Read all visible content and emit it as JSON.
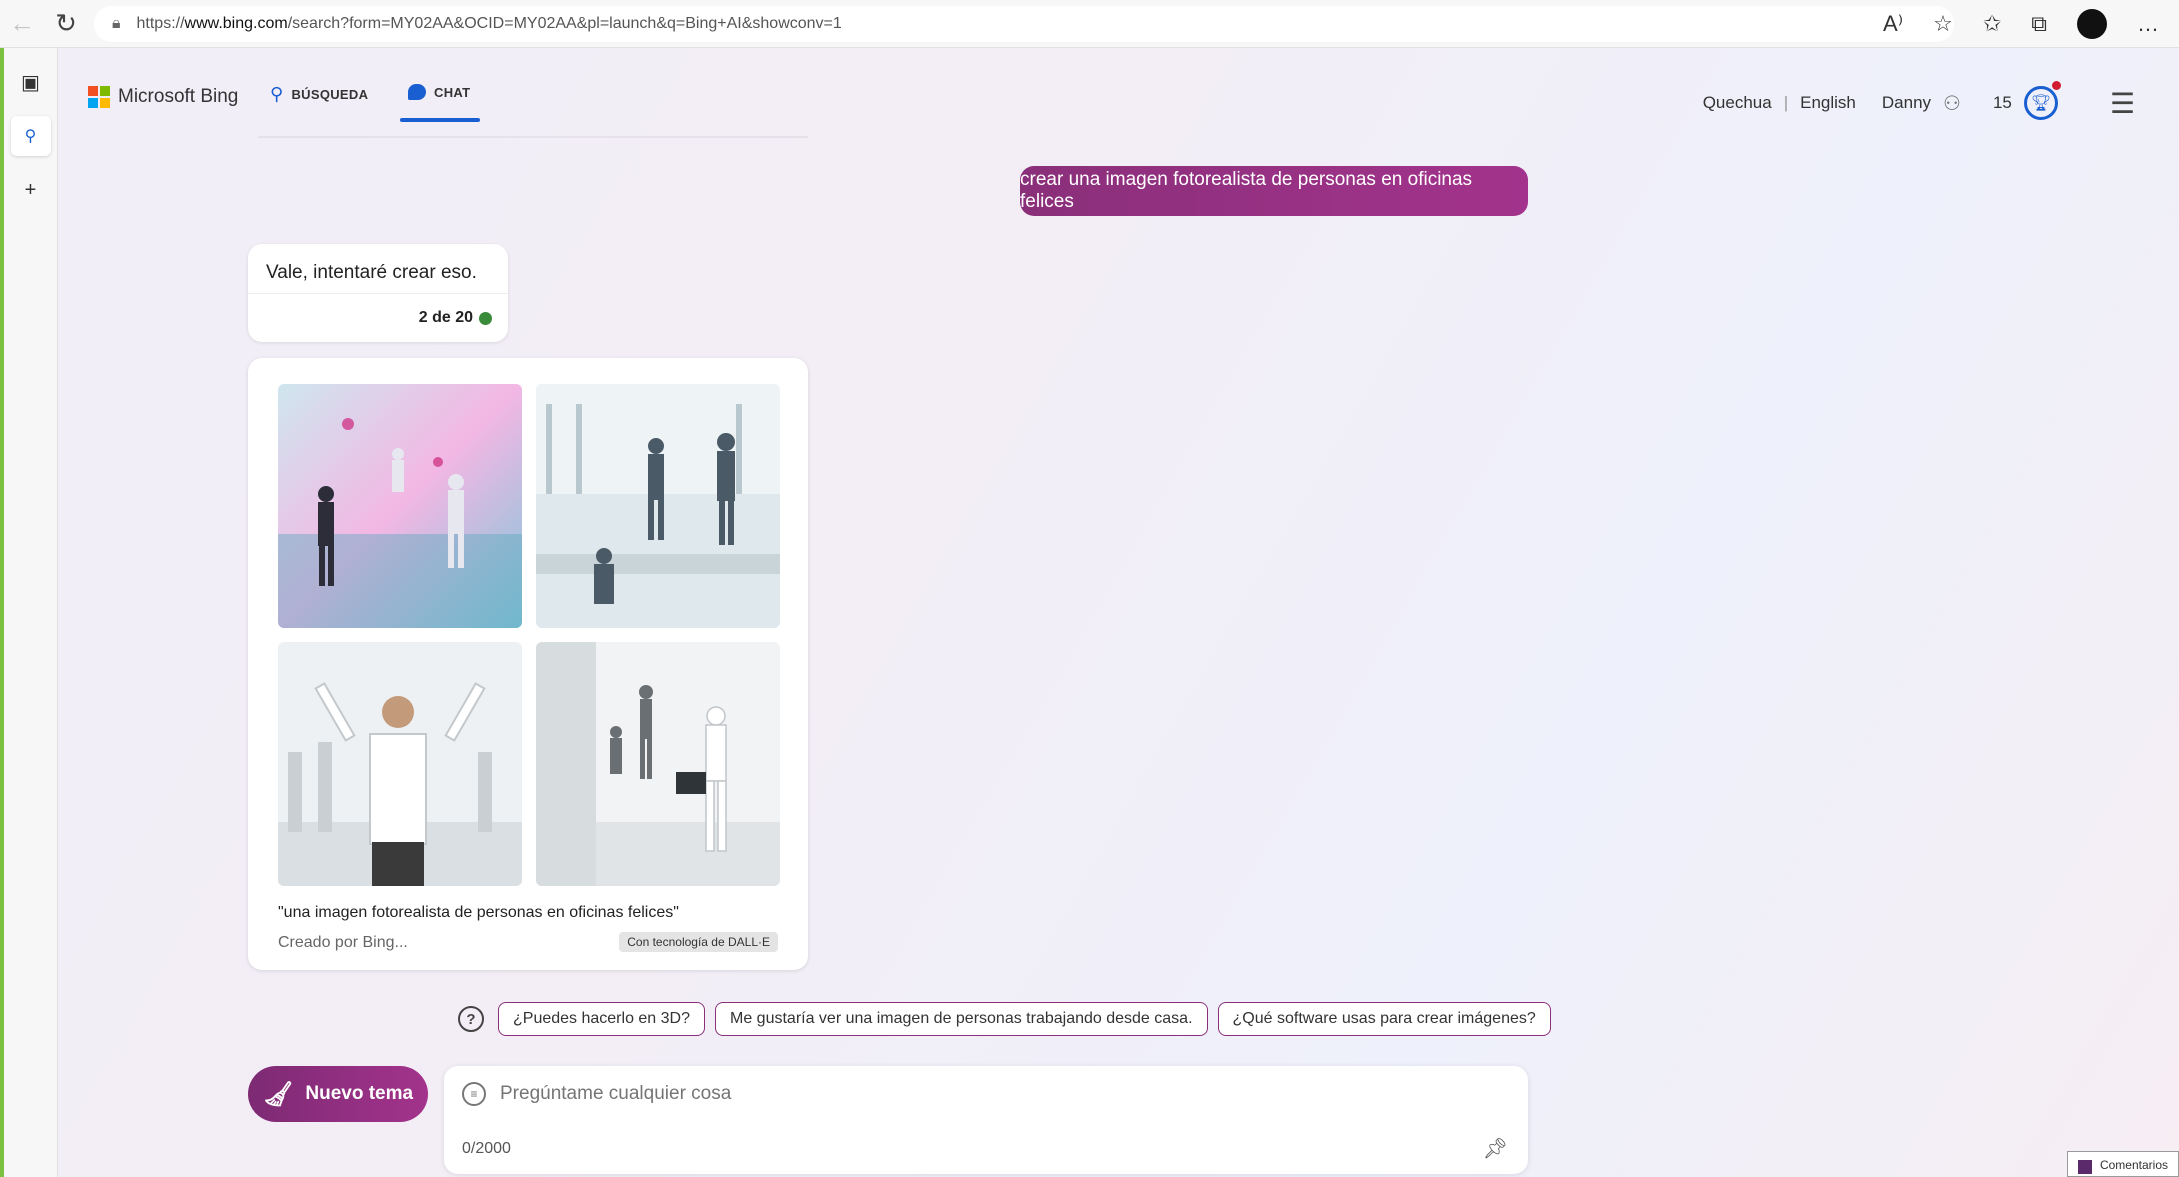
{
  "browser": {
    "url_prefix": "https://",
    "url_host": "www.bing.com",
    "url_rest": "/search?form=MY02AA&OCID=MY02AA&pl=launch&q=Bing+AI&showconv=1"
  },
  "header": {
    "logo_text": "Microsoft Bing",
    "tab_search": "BÚSQUEDA",
    "tab_chat": "CHAT",
    "lang_1": "Quechua",
    "separator": "|",
    "lang_2": "English",
    "user_name": "Danny",
    "rewards_count": "15"
  },
  "chat": {
    "user_message": "crear una imagen fotorealista de personas en oficinas felices",
    "bot_message": "Vale, intentaré crear eso.",
    "turn_counter": "2 de 20",
    "image_caption": "\"una imagen fotorealista de personas en oficinas felices\"",
    "created_by": "Creado por Bing...",
    "powered_by": "Con tecnología de DALL·E"
  },
  "suggestions": [
    "¿Puedes hacerlo en 3D?",
    "Me gustaría ver una imagen de personas trabajando desde casa.",
    "¿Qué software usas para crear imágenes?"
  ],
  "input": {
    "new_topic_label": "Nuevo tema",
    "placeholder": "Pregúntame cualquier cosa",
    "char_count": "0/2000"
  },
  "feedback_label": "Comentarios",
  "colors": {
    "accent": "#1a5fd1",
    "brand_magenta": "#a3338c",
    "green_status": "#3a8b3a"
  }
}
